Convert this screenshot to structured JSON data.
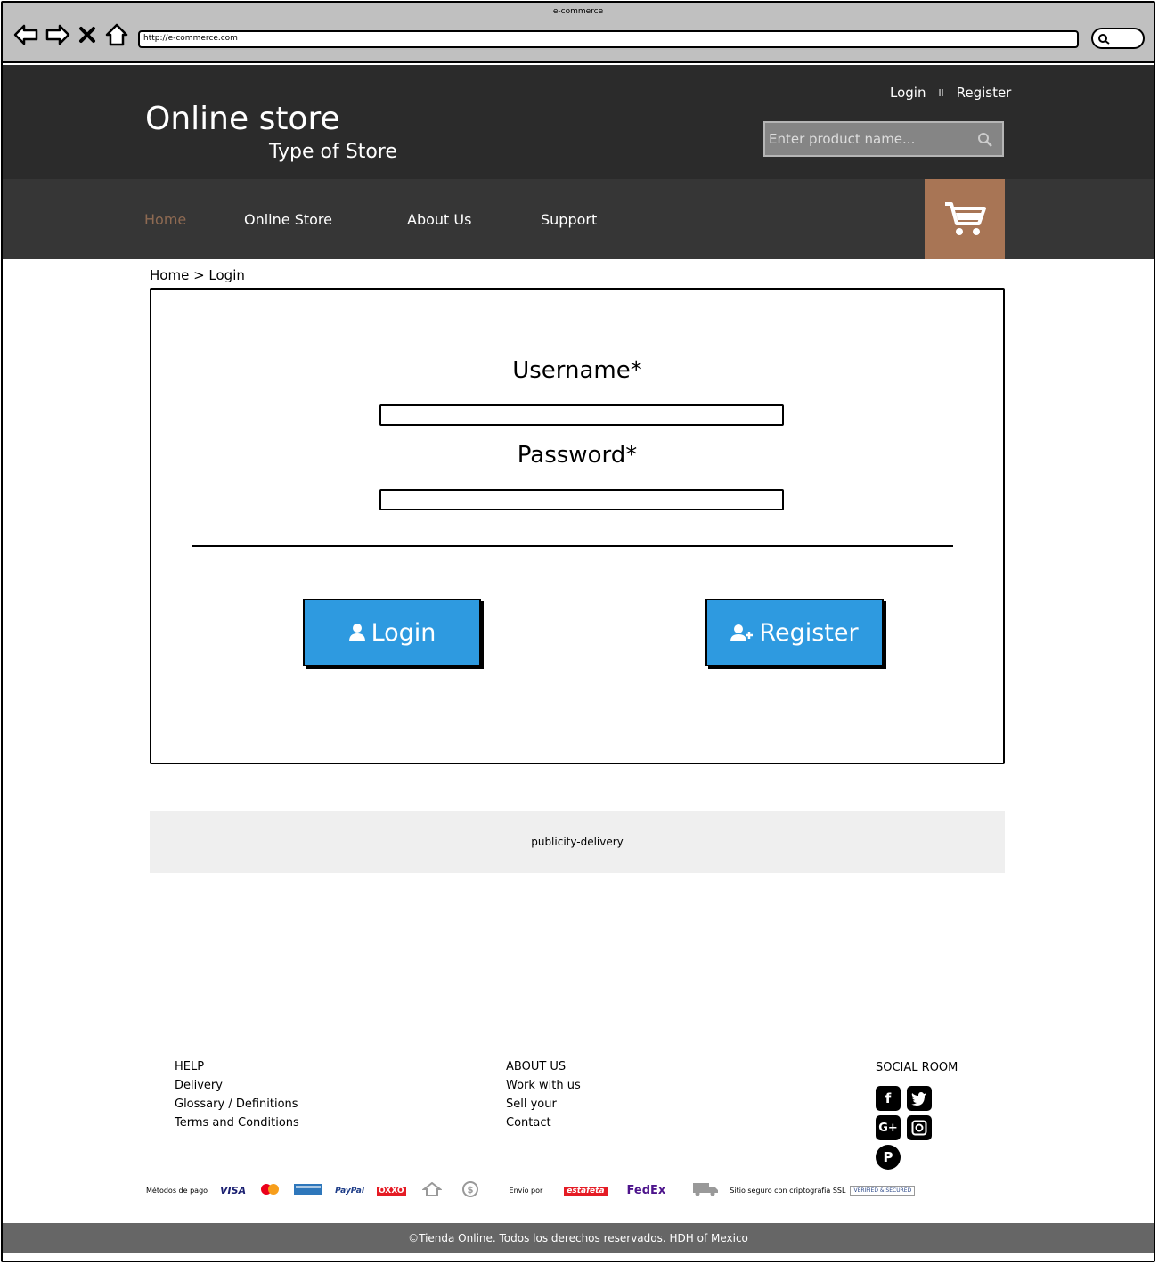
{
  "browser": {
    "title": "e-commerce",
    "url": "http://e-commerce.com"
  },
  "header": {
    "store_name": "Online store",
    "store_type": "Type of Store",
    "login_link": "Login",
    "separator": "ll",
    "register_link": "Register",
    "search_placeholder": "Enter product name..."
  },
  "nav": {
    "items": [
      {
        "label": "Home",
        "active": true
      },
      {
        "label": "Online Store",
        "active": false
      },
      {
        "label": "About Us",
        "active": false
      },
      {
        "label": "Support",
        "active": false
      }
    ]
  },
  "breadcrumb": "Home > Login",
  "login_form": {
    "username_label": "Username*",
    "password_label": "Password*",
    "login_button": "Login",
    "register_button": "Register"
  },
  "publicity": "publicity-delivery",
  "footer": {
    "help": {
      "title": "HELP",
      "items": [
        "Delivery",
        "Glossary / Definitions",
        "Terms and Conditions"
      ]
    },
    "about": {
      "title": "ABOUT US",
      "items": [
        "Work with us",
        "Sell your",
        "Contact"
      ]
    },
    "social_title": "SOCIAL ROOM",
    "payment_label": "Métodos de pago",
    "payment_methods": [
      "VISA",
      "PayPal",
      "OXXO"
    ],
    "shipping_label": "Envío por",
    "shipping_carriers": [
      "estafeta",
      "FedEx"
    ],
    "secure_label": "Sitio seguro con criptografía SSL",
    "secure_badge": "VERIFIED & SECURED",
    "copyright": "©Tienda Online. Todos los derechos reservados. HDH of Mexico"
  },
  "colors": {
    "header_bg": "#2b2b2b",
    "nav_bg": "#363636",
    "nav_active": "#8e6a52",
    "cart_bg": "#a87555",
    "button_bg": "#2e9ae0",
    "copyright_bg": "#666666"
  }
}
